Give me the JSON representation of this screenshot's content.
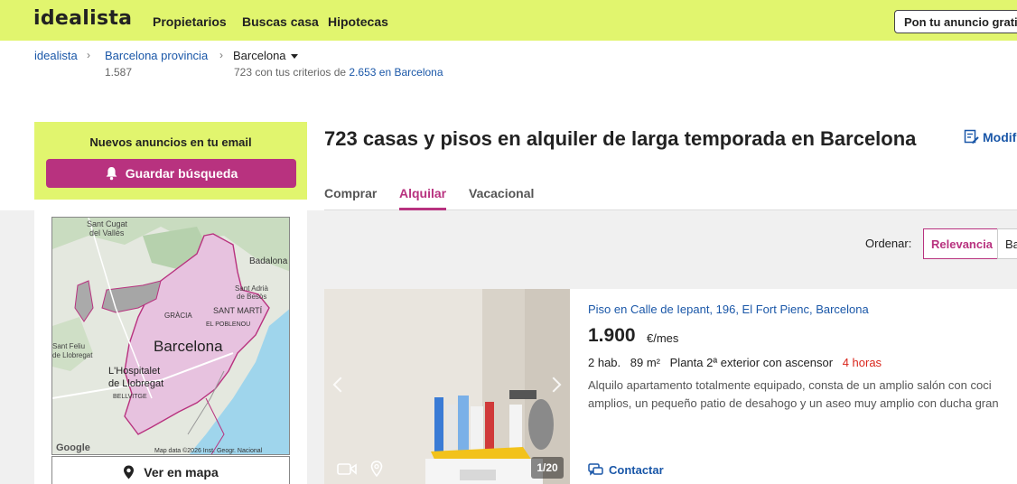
{
  "header": {
    "logo": "idealista",
    "nav": [
      "Propietarios",
      "Buscas casa",
      "Hipotecas"
    ],
    "post_ad": "Pon tu anuncio gratis"
  },
  "breadcrumb": {
    "items": [
      "idealista",
      "Barcelona provincia"
    ],
    "current": "Barcelona",
    "province_count": "1.587",
    "criteria_text": "723 con tus criterios de",
    "total_link": "2.653 en Barcelona"
  },
  "alert": {
    "title": "Nuevos anuncios en tu email",
    "button": "Guardar búsqueda"
  },
  "map": {
    "labels": {
      "sant_cugat": "Sant Cugat",
      "del_valles": "del Vallès",
      "badalona": "Badalona",
      "sant_adria": "Sant Adrià",
      "de_besos": "de Besòs",
      "sant_marti": "SANT MARTÍ",
      "gracia": "GRÀCIA",
      "poblenou": "EL POBLENOU",
      "barcelona": "Barcelona",
      "sant_feliu": "Sant Feliu",
      "de_llobregat": "de Llobregat",
      "hospitalet": "L'Hospitalet",
      "hospitalet2": "de Llobregat",
      "bellvitge": "BELLVITGE",
      "google": "Google",
      "attribution": "Map data ©2026 Inst. Geogr. Nacional"
    },
    "button": "Ver en mapa"
  },
  "results": {
    "heading": "723 casas y pisos en alquiler de larga temporada en Barcelona",
    "modify": "Modificar",
    "tabs": [
      "Comprar",
      "Alquilar",
      "Vacacional"
    ],
    "active_tab": "Alquilar"
  },
  "sort": {
    "label": "Ordenar:",
    "options": [
      "Relevancia",
      "Baratos"
    ],
    "selected": "Relevancia"
  },
  "listing": {
    "title": "Piso en Calle de Iepant, 196, El Fort Pienc, Barcelona",
    "price": "1.900",
    "price_unit": "€/mes",
    "rooms": "2 hab.",
    "area": "89 m²",
    "floor": "Planta 2ª exterior con ascensor",
    "time": "4 horas",
    "description_lines": [
      "Alquilo apartamento totalmente equipado, consta de un amplio salón con coci",
      "amplios, un pequeño patio de desahogo y un aseo muy amplio con ducha gran"
    ],
    "photo_counter": "1/20",
    "contact": "Contactar"
  },
  "colors": {
    "brand_lime": "#e1f56e",
    "accent_magenta": "#b8327f",
    "link_blue": "#1a57a8",
    "time_red": "#d9261c"
  },
  "icons": [
    "bell-icon",
    "pin-icon",
    "edit-search-icon",
    "video-icon",
    "location-icon",
    "chat-icon",
    "chevron-left-icon",
    "chevron-right-icon"
  ]
}
